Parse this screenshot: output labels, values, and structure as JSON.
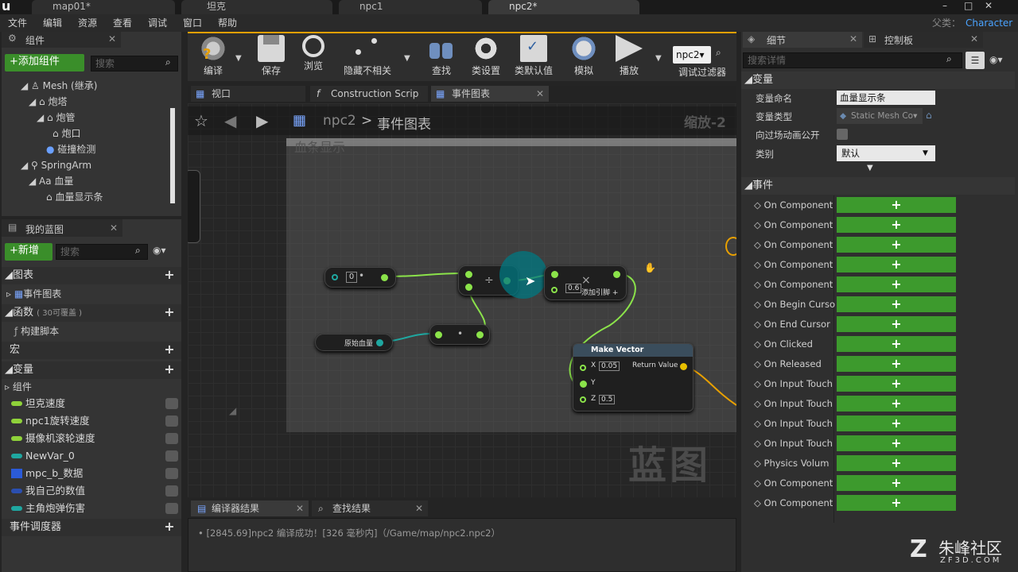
{
  "window": {
    "tabs": [
      "map01*",
      "坦克",
      "npc1",
      "npc2*"
    ],
    "parent_label": "父类：",
    "parent_value": "Character"
  },
  "menu": [
    "文件",
    "编辑",
    "资源",
    "查看",
    "调试",
    "窗口",
    "帮助"
  ],
  "components_panel": {
    "title": "组件",
    "add_label": "+添加组件",
    "search_placeholder": "搜索",
    "tree": [
      {
        "label": "Mesh (继承)",
        "indent": 0
      },
      {
        "label": "炮塔",
        "indent": 1
      },
      {
        "label": "炮管",
        "indent": 2
      },
      {
        "label": "炮口",
        "indent": 3
      },
      {
        "label": "碰撞检测",
        "indent": 2
      },
      {
        "label": "SpringArm",
        "indent": 0
      },
      {
        "label": "Aa 血量",
        "indent": 1
      },
      {
        "label": "血量显示条",
        "indent": 2
      }
    ]
  },
  "blueprint_panel": {
    "title": "我的蓝图",
    "new_label": "+新增",
    "search_placeholder": "搜索",
    "graphs_label": "图表",
    "event_graph": "事件图表",
    "functions_label": "函数",
    "functions_note": "( 30可覆盖 )",
    "construct_script": "构建脚本",
    "macros_label": "宏",
    "variables_label": "变量",
    "components_label": "组件",
    "variables": [
      {
        "name": "坦克速度",
        "color": "#8fd23a"
      },
      {
        "name": "npc1旋转速度",
        "color": "#8fd23a"
      },
      {
        "name": "摄像机滚轮速度",
        "color": "#8fd23a"
      },
      {
        "name": "NewVar_0",
        "color": "#1fa7a0"
      },
      {
        "name": "mpc_b_数据",
        "color": "#2b5bd8"
      },
      {
        "name": "我自己的数值",
        "color": "#2b4fb0"
      },
      {
        "name": "主角炮弹伤害",
        "color": "#1fa7a0"
      }
    ],
    "dispatchers_label": "事件调度器"
  },
  "toolbar": {
    "buttons": [
      "编译",
      "保存",
      "浏览",
      "隐藏不相关",
      "查找",
      "类设置",
      "类默认值",
      "模拟",
      "播放"
    ],
    "debug_select": "npc2▾",
    "debug_filter": "调试过滤器"
  },
  "graph_tabs": [
    "视口",
    "Construction Scrip",
    "事件图表"
  ],
  "graph": {
    "breadcrumb_root": "npc2",
    "breadcrumb_sep": ">",
    "breadcrumb_current": "事件图表",
    "zoom": "缩放-2",
    "comment": "血条显示",
    "watermark": "蓝图",
    "nodes": {
      "int_value": "0",
      "lerp_value": "0.6",
      "add_pin": "添加引脚",
      "var_name": "原始血量",
      "make_vector": "Make Vector",
      "x_label": "X",
      "x_value": "0.05",
      "y_label": "Y",
      "z_label": "Z",
      "z_value": "0.5",
      "return_value": "Return Value"
    }
  },
  "output": {
    "tab_compiler": "编译器结果",
    "tab_find": "查找结果",
    "message": "[2845.69]npc2 编译成功！[326 毫秒内]（/Game/map/npc2.npc2）"
  },
  "details": {
    "tab_details": "细节",
    "tab_palette": "控制板",
    "search_placeholder": "搜索详情",
    "variables_section": "变量",
    "var_name_label": "变量命名",
    "var_name_value": "血量显示条",
    "var_type_label": "变量类型",
    "var_type_value": "Static Mesh Co▾",
    "cinematic_label": "向过场动画公开",
    "category_label": "类别",
    "category_value": "默认",
    "events_section": "事件",
    "events": [
      "On Component",
      "On Component",
      "On Component",
      "On Component",
      "On Component",
      "On Begin Curso",
      "On End Cursor",
      "On Clicked",
      "On Released",
      "On Input Touch",
      "On Input Touch",
      "On Input Touch",
      "On Input Touch",
      "Physics Volum",
      "On Component",
      "On Component"
    ]
  },
  "watermark_brand": "朱峰社区",
  "watermark_url": "ZF3D.COM",
  "colors": {
    "accent_green": "#3d9a2d",
    "exec_green": "#8be34a",
    "teal": "#1fa7a0"
  }
}
